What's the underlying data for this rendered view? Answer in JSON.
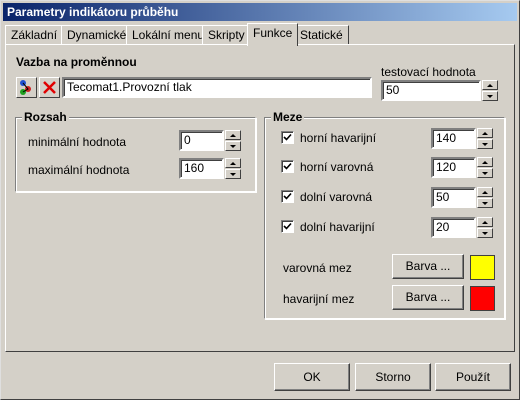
{
  "window": {
    "title": "Parametry indikátoru průběhu"
  },
  "tabs": [
    "Základní",
    "Dynamické",
    "Lokální menu",
    "Skripty",
    "Funkce",
    "Statické"
  ],
  "active_tab": "Funkce",
  "binding": {
    "label": "Vazba na proměnnou",
    "variable": "Tecomat1.Provozní tlak",
    "test_label": "testovací hodnota",
    "test_value": "50"
  },
  "range": {
    "title": "Rozsah",
    "min_label": "minimální hodnota",
    "min_value": "0",
    "max_label": "maximální hodnota",
    "max_value": "160"
  },
  "limits": {
    "title": "Meze",
    "items": [
      {
        "label": "horní havarijní",
        "value": "140",
        "checked": true
      },
      {
        "label": "horní varovná",
        "value": "120",
        "checked": true
      },
      {
        "label": "dolní varovná",
        "value": "50",
        "checked": true
      },
      {
        "label": "dolní havarijní",
        "value": "20",
        "checked": true
      }
    ],
    "warning_label": "varovná mez",
    "warning_button": "Barva ...",
    "warning_color": "#ffff00",
    "alarm_label": "havarijní mez",
    "alarm_button": "Barva ...",
    "alarm_color": "#ff0000"
  },
  "buttons": {
    "ok": "OK",
    "cancel": "Storno",
    "apply": "Použít"
  },
  "icons": {
    "variable_select": "variable-picker-icon",
    "clear": "red-x-icon"
  }
}
